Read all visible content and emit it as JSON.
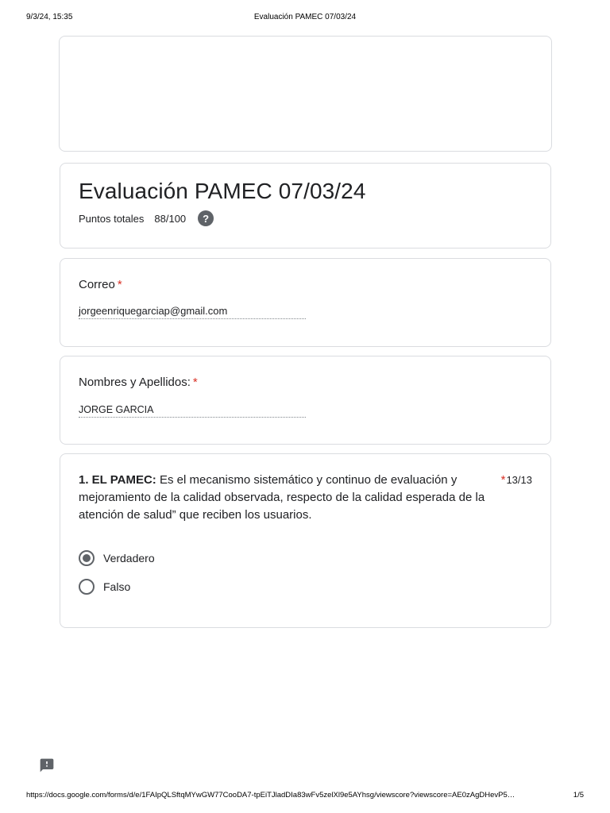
{
  "print_header": {
    "datetime": "9/3/24, 15:35",
    "page_title": "Evaluación PAMEC 07/03/24"
  },
  "form": {
    "title": "Evaluación PAMEC 07/03/24",
    "score_label": "Puntos totales",
    "score_value": "88/100",
    "help_glyph": "?"
  },
  "fields": {
    "email": {
      "label": "Correo",
      "required_mark": "*",
      "value": "jorgeenriquegarciap@gmail.com"
    },
    "name": {
      "label": "Nombres y Apellidos:",
      "required_mark": "*",
      "value": "JORGE GARCIA"
    }
  },
  "question_1": {
    "title_bold": "1. EL PAMEC:",
    "text": " Es el mecanismo sistemático y continuo de evaluación y mejoramiento de la calidad observada, respecto de la calidad esperada de la atención de salud” que reciben los usuarios.",
    "required_mark": "*",
    "points": "13/13",
    "options": [
      {
        "label": "Verdadero",
        "selected": true
      },
      {
        "label": "Falso",
        "selected": false
      }
    ]
  },
  "print_footer": {
    "url": "https://docs.google.com/forms/d/e/1FAIpQLSftqMYwGW77CooDA7-tpEiTJladDIa83wFv5zelXl9e5AYhsg/viewscore?viewscore=AE0zAgDHevP5…",
    "page_number": "1/5"
  },
  "icons": {
    "help": "help-circle-icon",
    "feedback": "feedback-icon"
  },
  "colors": {
    "required": "#d93025",
    "border": "#dadce0",
    "icon_gray": "#5f6368"
  }
}
